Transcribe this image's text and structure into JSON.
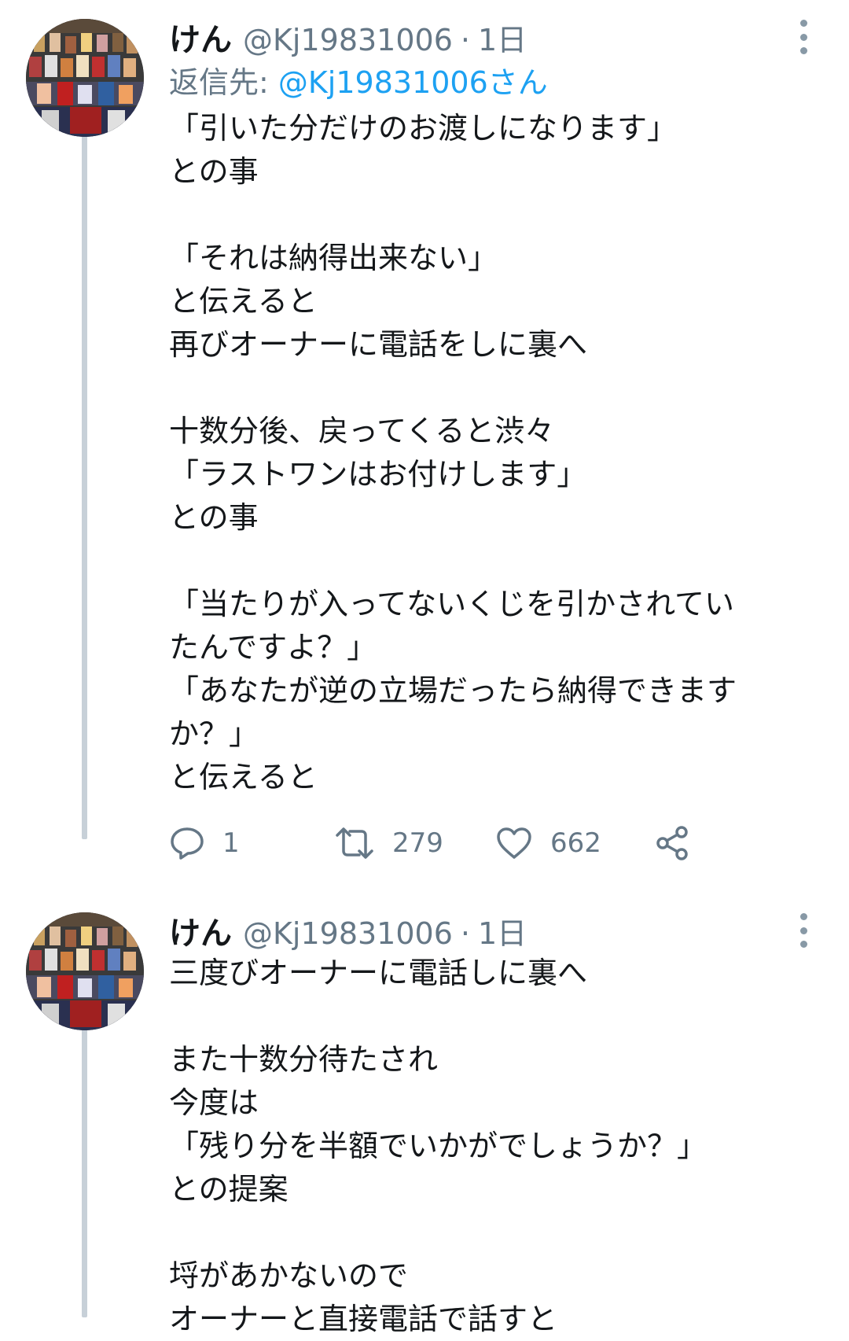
{
  "tweets": [
    {
      "name": "けん",
      "handle": "@Kj19831006",
      "separator": "·",
      "time": "1日",
      "reply_label": "返信先: ",
      "reply_target": "@Kj19831006さん",
      "lines": [
        "「引いた分だけのお渡しになります」",
        "との事",
        "",
        "「それは納得出来ない」",
        "と伝えると",
        "再びオーナーに電話をしに裏へ",
        "",
        "十数分後、戻ってくると渋々",
        "「ラストワンはお付けします」",
        "との事",
        "",
        "「当たりが入ってないくじを引かされてい",
        "たんですよ？」",
        "「あなたが逆の立場だったら納得できます",
        "か？」",
        "と伝えると"
      ],
      "actions": {
        "replies": "1",
        "retweets": "279",
        "likes": "662"
      }
    },
    {
      "name": "けん",
      "handle": "@Kj19831006",
      "separator": "·",
      "time": "1日",
      "lines": [
        "三度びオーナーに電話しに裏へ",
        "",
        "また十数分待たされ",
        "今度は",
        "「残り分を半額でいかがでしょうか？」",
        "との提案",
        "",
        "埒があかないので",
        "オーナーと直接電話で話すと"
      ]
    }
  ],
  "icons": {
    "reply": "reply-icon",
    "retweet": "retweet-icon",
    "like": "heart-icon",
    "share": "share-icon",
    "more": "more-vertical-icon"
  },
  "colors": {
    "text": "#14171a",
    "secondary": "#657786",
    "link": "#1da1f2",
    "thread_line": "#c7d0d8"
  }
}
